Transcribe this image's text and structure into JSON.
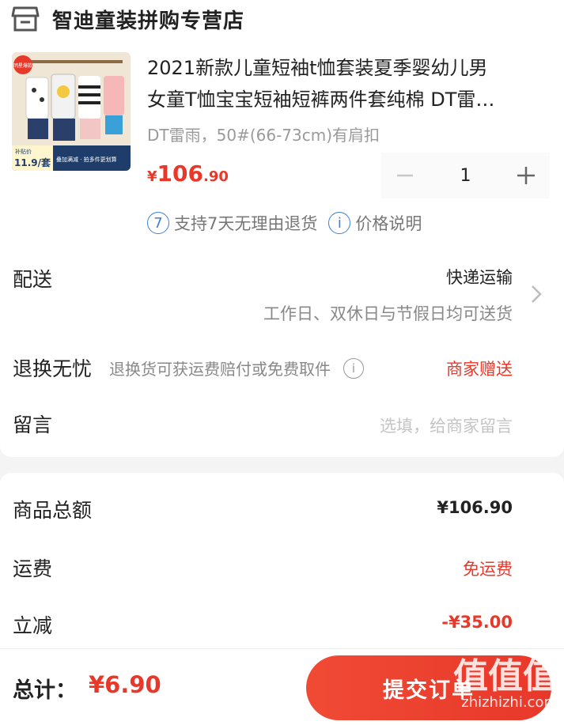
{
  "shop": {
    "name": "智迪童装拼购专营店",
    "icon": "shop-icon"
  },
  "product": {
    "title_line1": "2021新款儿童短袖t恤套装夏季婴幼儿男",
    "title_line2": "女童T恤宝宝短袖短裤两件套纯棉 DT雷…",
    "spec": "DT雷雨，50#(66-73cm)有肩扣",
    "price_currency": "¥",
    "price_int": "106",
    "price_dec": ".90",
    "quantity": "1",
    "thumb_badge_top": "补贴价",
    "thumb_price": "11.9/套",
    "thumb_banner": "叠加满减 · 拍多件更划算",
    "thumb_tag": "明星爆款"
  },
  "policies": {
    "return_badge": "7",
    "return_text": "支持7天无理由退货",
    "price_badge": "i",
    "price_text": "价格说明"
  },
  "delivery": {
    "label": "配送",
    "method": "快递运输",
    "note": "工作日、双休日与节假日均可送货"
  },
  "exchange": {
    "label": "退换无忧",
    "desc": "退换货可获运费赔付或免费取件",
    "badge": "i",
    "right": "商家赠送"
  },
  "message": {
    "label": "留言",
    "placeholder": "选填，给商家留言"
  },
  "summary": {
    "goods_label": "商品总额",
    "goods_value": "¥106.90",
    "shipping_label": "运费",
    "shipping_value": "免运费",
    "discount_label": "立减",
    "discount_value": "-¥35.00"
  },
  "bottom": {
    "total_label": "总计：",
    "total_value": "¥6.90",
    "submit_label": "提交订单",
    "watermark_big": "值值值",
    "watermark_small": "zhizhizhi.com"
  },
  "colors": {
    "accent_red": "#e8382a",
    "info_blue": "#3d7fd1"
  }
}
